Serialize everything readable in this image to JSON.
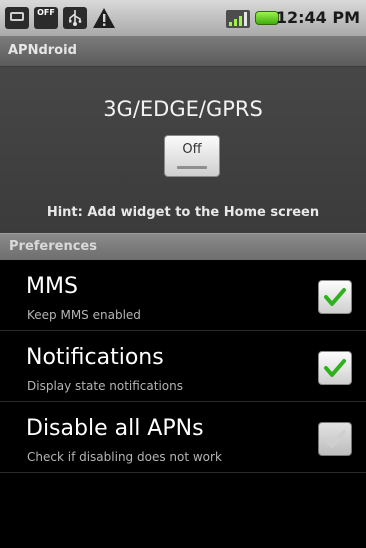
{
  "status_bar": {
    "off_icon_text": "OFF",
    "time": "12:44 PM",
    "icons": [
      "sd-card-icon",
      "off-icon",
      "usb-icon",
      "warning-icon",
      "signal-icon",
      "battery-icon"
    ]
  },
  "app": {
    "title": "APNdroid"
  },
  "header": {
    "network_label": "3G/EDGE/GPRS",
    "toggle_label": "Off",
    "hint": "Hint: Add widget to the Home screen"
  },
  "preferences": {
    "heading": "Preferences",
    "items": [
      {
        "title": "MMS",
        "summary": "Keep MMS enabled",
        "checked": true
      },
      {
        "title": "Notifications",
        "summary": "Display state notifications",
        "checked": true
      },
      {
        "title": "Disable all APNs",
        "summary": "Check if disabling does not work",
        "checked": false
      }
    ]
  },
  "colors": {
    "check_green": "#2fb11e",
    "background": "#000000"
  }
}
